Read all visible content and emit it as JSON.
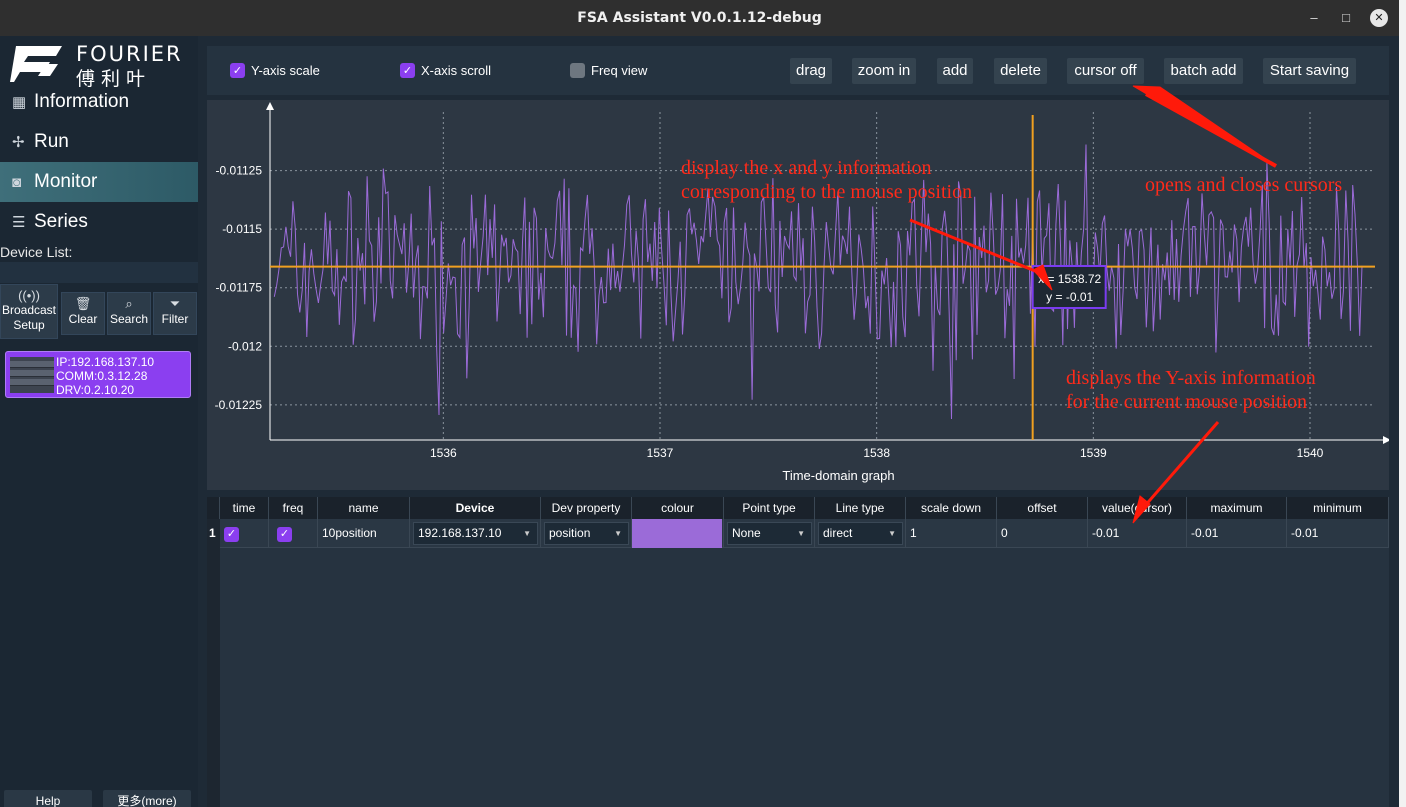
{
  "window": {
    "title": "FSA Assistant V0.0.1.12-debug",
    "min": "–",
    "max": "□",
    "close": "✕"
  },
  "sidebar": {
    "logo_line1": "FOURIER",
    "logo_line2": "傅利叶",
    "nav": [
      {
        "label": "Information",
        "icon": "grid-icon"
      },
      {
        "label": "Run",
        "icon": "fan-icon"
      },
      {
        "label": "Monitor",
        "icon": "monitor-icon"
      },
      {
        "label": "Series",
        "icon": "sliders-icon"
      }
    ],
    "device_list_label": "Device List:",
    "tools": {
      "broadcast": "Broadcast Setup",
      "clear": "Clear",
      "search": "Search",
      "filter": "Filter"
    },
    "device": {
      "ip": "IP:192.168.137.10",
      "comm": "COMM:0.3.12.28",
      "drv": "DRV:0.2.10.20"
    },
    "bottom": {
      "help": "Help",
      "more": "更多(more)"
    }
  },
  "toolbar": {
    "y_axis_scale": "Y-axis scale",
    "x_axis_scroll": "X-axis scroll",
    "freq_view": "Freq view",
    "y_axis_checked": true,
    "x_axis_checked": true,
    "freq_checked": false,
    "buttons": {
      "drag": "drag",
      "zoom_in": "zoom in",
      "add": "add",
      "delete": "delete",
      "cursor_off": "cursor off",
      "batch_add": "batch add",
      "start_saving": "Start saving"
    }
  },
  "chart_data": {
    "type": "line",
    "xlabel": "Time-domain graph",
    "ylabel": "",
    "x_ticks": [
      "1536",
      "1537",
      "1538",
      "1539",
      "1540"
    ],
    "y_ticks": [
      "-0.01125",
      "-0.0115",
      "-0.01175",
      "-0.012",
      "-0.01225"
    ],
    "xlim": [
      1535.2,
      1540.3
    ],
    "ylim": [
      -0.0124,
      -0.011
    ],
    "series_color": "#9b6bd8",
    "cursor_h_y": -0.01166,
    "cursor_v_x": 1538.72,
    "cursor_color": "#f0a020",
    "tooltip": {
      "x_text": "x = 1538.72",
      "y_text": "y = -0.01"
    }
  },
  "table": {
    "columns": [
      "time",
      "freq",
      "name",
      "Device",
      "Dev property",
      "colour",
      "Point type",
      "Line type",
      "scale down",
      "offset",
      "value(cursor)",
      "maximum",
      "minimum"
    ],
    "row_number": "1",
    "row": {
      "name": "10position",
      "device": "192.168.137.10",
      "dev_property": "position",
      "colour": "#9b6bd8",
      "point_type": "None",
      "line_type": "direct",
      "scale_down": "1",
      "offset": "0",
      "value": "-0.01",
      "maximum": "-0.01",
      "minimum": "-0.01"
    }
  },
  "annotations": {
    "cursor_info_1": "display the x and y information",
    "cursor_info_2": "corresponding to the mouse position",
    "cursor_toggle": "opens and closes cursors",
    "y_info_1": "displays the Y-axis information",
    "y_info_2": "for the current mouse position"
  }
}
